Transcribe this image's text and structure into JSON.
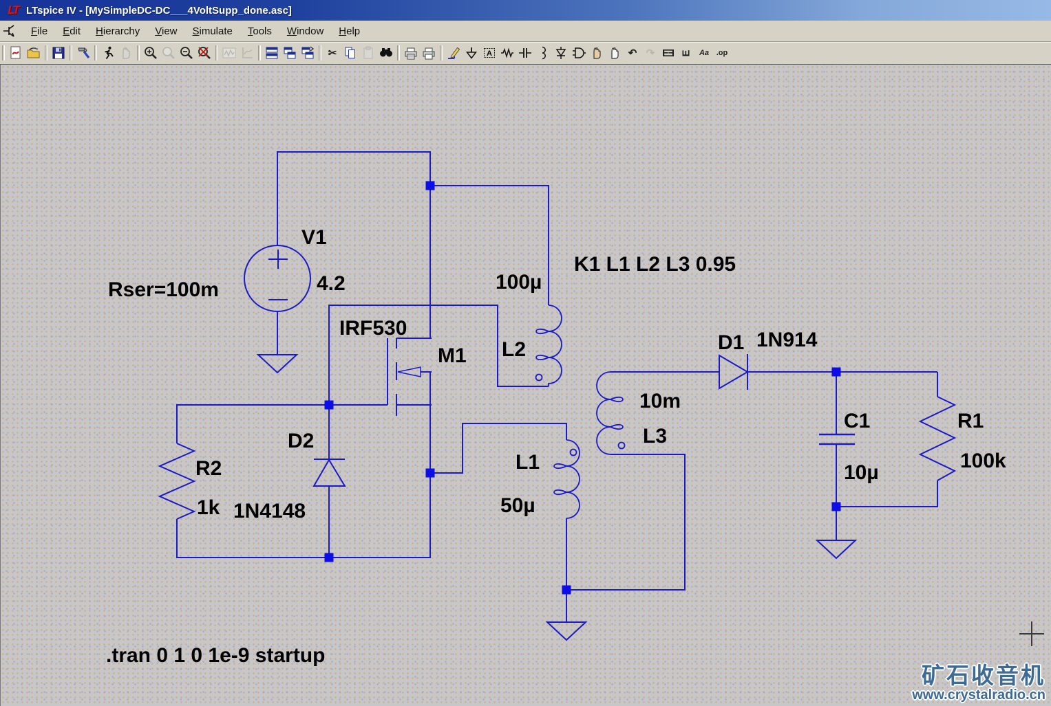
{
  "window": {
    "title": "LTspice IV - [MySimpleDC-DC___4VoltSupp_done.asc]",
    "logo_text": "LT"
  },
  "menu": {
    "items": [
      {
        "label": "File"
      },
      {
        "label": "Edit"
      },
      {
        "label": "Hierarchy"
      },
      {
        "label": "View"
      },
      {
        "label": "Simulate"
      },
      {
        "label": "Tools"
      },
      {
        "label": "Window"
      },
      {
        "label": "Help"
      }
    ]
  },
  "toolbar": {
    "glyphs": {
      "cut": "✂",
      "undo": "↶",
      "redo": "↷",
      "mirror": "E",
      "rotate": "E",
      "text": "Aa",
      "op": ".op",
      "label": "A"
    },
    "buttons": [
      {
        "name": "new-schematic",
        "enabled": true
      },
      {
        "name": "open",
        "enabled": true
      },
      {
        "name": "save",
        "enabled": true
      },
      {
        "name": "control-panel",
        "enabled": true
      },
      {
        "name": "run",
        "enabled": true
      },
      {
        "name": "halt",
        "enabled": false
      },
      {
        "name": "zoom-in",
        "enabled": true
      },
      {
        "name": "zoom-back",
        "enabled": false
      },
      {
        "name": "zoom-out",
        "enabled": true
      },
      {
        "name": "zoom-full-extents",
        "enabled": true
      },
      {
        "name": "autorange-waveform",
        "enabled": false
      },
      {
        "name": "plot-settings",
        "enabled": false
      },
      {
        "name": "tile-horizontally",
        "enabled": true
      },
      {
        "name": "tile-vertically",
        "enabled": true
      },
      {
        "name": "cascade-windows",
        "enabled": true
      },
      {
        "name": "cut",
        "enabled": true
      },
      {
        "name": "copy",
        "enabled": true
      },
      {
        "name": "paste",
        "enabled": false
      },
      {
        "name": "find",
        "enabled": true
      },
      {
        "name": "print-preview",
        "enabled": true
      },
      {
        "name": "print",
        "enabled": true
      },
      {
        "name": "draw-wire",
        "enabled": true
      },
      {
        "name": "place-ground",
        "enabled": true
      },
      {
        "name": "net-label",
        "enabled": true
      },
      {
        "name": "place-resistor",
        "enabled": true
      },
      {
        "name": "place-capacitor",
        "enabled": true
      },
      {
        "name": "place-inductor",
        "enabled": true
      },
      {
        "name": "place-diode",
        "enabled": true
      },
      {
        "name": "place-component",
        "enabled": true
      },
      {
        "name": "move",
        "enabled": true
      },
      {
        "name": "drag",
        "enabled": true
      },
      {
        "name": "undo",
        "enabled": true
      },
      {
        "name": "redo",
        "enabled": false
      },
      {
        "name": "mirror",
        "enabled": true
      },
      {
        "name": "rotate",
        "enabled": true
      },
      {
        "name": "place-text",
        "enabled": true
      },
      {
        "name": "spice-directive",
        "enabled": true
      }
    ]
  },
  "schematic": {
    "colors": {
      "wire": "#1a1ac8",
      "junction": "#0d0de8",
      "text": "#000000"
    },
    "directive": ".tran 0 1 0 1e-9 startup",
    "coupling": "K1 L1 L2 L3 0.95",
    "components": {
      "V1": {
        "value": "4.2",
        "series_resistance": "Rser=100m"
      },
      "M1": {
        "model": "IRF530"
      },
      "L1": {
        "value": "50µ"
      },
      "L2": {
        "value": "100µ"
      },
      "L3": {
        "value": "10m"
      },
      "D1": {
        "model": "1N914"
      },
      "D2": {
        "model": "1N4148"
      },
      "R1": {
        "value": "100k"
      },
      "R2": {
        "value": "1k"
      },
      "C1": {
        "value": "10µ"
      }
    },
    "labels": [
      {
        "text": "V1"
      },
      {
        "text": "4.2"
      },
      {
        "text": "Rser=100m"
      },
      {
        "text": "IRF530"
      },
      {
        "text": "M1"
      },
      {
        "text": "100µ"
      },
      {
        "text": "K1 L1 L2 L3 0.95"
      },
      {
        "text": "L2"
      },
      {
        "text": "L1"
      },
      {
        "text": "50µ"
      },
      {
        "text": "10m"
      },
      {
        "text": "L3"
      },
      {
        "text": "D1"
      },
      {
        "text": "1N914"
      },
      {
        "text": "D2"
      },
      {
        "text": "1N4148"
      },
      {
        "text": "R2"
      },
      {
        "text": "1k"
      },
      {
        "text": "C1"
      },
      {
        "text": "10µ"
      },
      {
        "text": "R1"
      },
      {
        "text": "100k"
      },
      {
        "text": ".tran 0 1 0 1e-9 startup"
      }
    ]
  },
  "watermark": {
    "line1": "矿石收音机",
    "line2": "www.crystalradio.cn",
    "color": "#3e6b96"
  }
}
